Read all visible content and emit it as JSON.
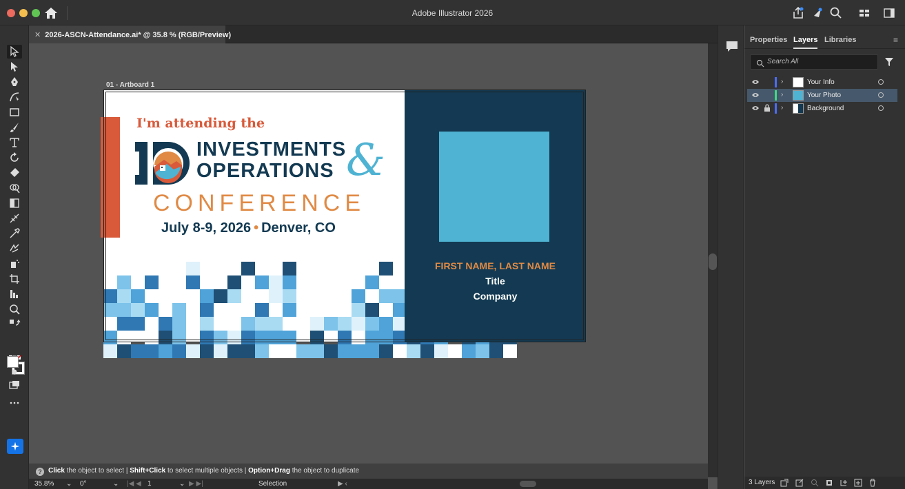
{
  "window": {
    "title": "Adobe Illustrator 2026"
  },
  "document": {
    "tab_label": "2026-ASCN-Attendance.ai* @ 35.8 % (RGB/Preview)",
    "artboard_label": "01 - Artboard 1"
  },
  "artwork": {
    "attending": "I'm attending the",
    "line1": "INVESTMENTS",
    "line2": "OPERATIONS",
    "ampersand": "&",
    "conference": "CONFERENCE",
    "date_text": "July 8-9, 2026",
    "separator": "•",
    "location": "Denver, CO",
    "name": "FIRST NAME, LAST NAME",
    "title": "Title",
    "company": "Company",
    "colors": {
      "navy": "#133a52",
      "orange": "#d85a3a",
      "gold": "#e08a45",
      "sky": "#4fb3d3"
    }
  },
  "panel": {
    "tabs": [
      "Properties",
      "Layers",
      "Libraries"
    ],
    "active_tab": "Layers",
    "search_placeholder": "Search All",
    "layers": [
      {
        "name": "Your Info",
        "color": "#4a6cf7",
        "selected": false,
        "locked": false
      },
      {
        "name": "Your Photo",
        "color": "#3ddc84",
        "selected": true,
        "locked": false
      },
      {
        "name": "Background",
        "color": "#4a6cf7",
        "selected": false,
        "locked": true
      }
    ],
    "layer_count": "3 Layers"
  },
  "status": {
    "hint_click": "Click",
    "hint_click_text": "the object to select",
    "hint_shift": "Shift+Click",
    "hint_shift_text": "to select multiple objects",
    "hint_option": "Option+Drag",
    "hint_option_text": "the object to duplicate",
    "separator": "|",
    "zoom": "35.8%",
    "rotation": "0°",
    "artboard_number": "1",
    "tool_name": "Selection"
  },
  "tools": [
    "selection-tool-icon",
    "direct-selection-tool-icon",
    "pen-tool-icon",
    "curvature-tool-icon",
    "rectangle-tool-icon",
    "brush-tool-icon",
    "type-tool-icon",
    "rotate-tool-icon",
    "eraser-tool-icon",
    "shape-builder-tool-icon",
    "gradient-tool-icon",
    "mesh-tool-icon",
    "eyedropper-tool-icon",
    "blend-tool-icon",
    "symbol-sprayer-tool-icon",
    "artboard-tool-icon",
    "graph-tool-icon",
    "zoom-tool-icon"
  ]
}
